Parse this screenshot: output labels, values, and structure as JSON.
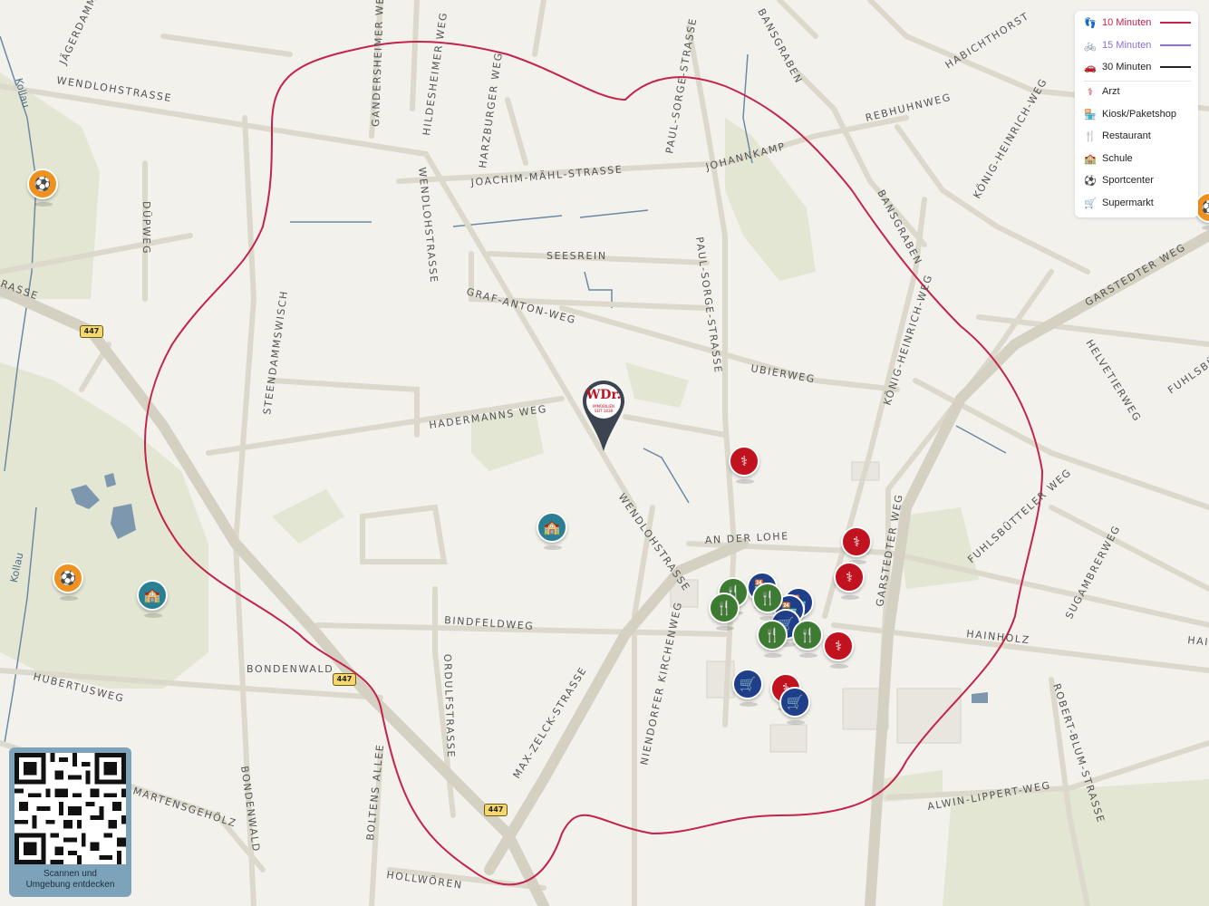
{
  "legend": {
    "travel": [
      {
        "label": "10 Minuten",
        "icon": "walk-icon",
        "color": "#c4234b"
      },
      {
        "label": "15 Minuten",
        "icon": "bike-icon",
        "color": "#8c6ee3"
      },
      {
        "label": "30 Minuten",
        "icon": "car-icon",
        "color": "#222222"
      }
    ],
    "categories": [
      {
        "label": "Arzt",
        "icon": "stethoscope-icon",
        "color": "#c1121f"
      },
      {
        "label": "Kiosk/Paketshop",
        "icon": "shop-icon",
        "color": "#1f3f8a"
      },
      {
        "label": "Restaurant",
        "icon": "cutlery-icon",
        "color": "#3e7b32"
      },
      {
        "label": "Schule",
        "icon": "school-icon",
        "color": "#2b7f94"
      },
      {
        "label": "Sportcenter",
        "icon": "stadium-icon",
        "color": "#f0901e"
      },
      {
        "label": "Supermarkt",
        "icon": "cart-icon",
        "color": "#1f3f8a"
      }
    ]
  },
  "streets": [
    "JÄGERDAMM",
    "WENDLOHSTRASSE",
    "GANDERSHEIMER WEG",
    "HILDESHEIMER WEG",
    "HARZBURGER WEG",
    "PAUL-SORGE-STRASSE",
    "BANSGRABEN",
    "HABICHTHORST",
    "REBHUHNWEG",
    "KÖNIG-HEINRICH-WEG",
    "JOACHIM-MÄHL-STRASSE",
    "JOHANNKAMP",
    "DÜPWEG",
    "WENDLOHSTRASSE",
    "SEESREIN",
    "BANSGRABEN",
    "GARSTEDTER WEG",
    "GRAF-ANTON-WEG",
    "PAUL-SORGE-STRASSE",
    "STEENDAMMSWISCH",
    "UBIERWEG",
    "KÖNIG-HEINRICH-WEG",
    "HELVETIERWEG",
    "FUHLSBÜ",
    "HADERMANNS WEG",
    "WENDLOHSTRASSE",
    "AN DER LOHE",
    "FUHLSBÜTTELER WEG",
    "SUGAMBRERWEG",
    "GARSTEDTER WEG",
    "BINDFELDWEG",
    "HAINHOLZ",
    "HAI",
    "NIENDORFER KIRCHENWEG",
    "ORDULFSTRASSE",
    "BONDENWALD",
    "HUBERTUSWEG",
    "MAX-ZELCK-STRASSE",
    "ROBERT-BLUM-STRASSE",
    "MARTENSGEHÖLZ",
    "BONDENWALD",
    "BOLTENS ALLEE",
    "ALWIN-LIPPERT-WEG",
    "HOLLWÖREN",
    "RASSE"
  ],
  "rivers": [
    "Kollau",
    "Kollau"
  ],
  "route_badges": [
    "447",
    "447",
    "447"
  ],
  "pois": [
    {
      "category": "Sportcenter",
      "icon": "stadium-icon",
      "glyph": "⚽"
    },
    {
      "category": "Sportcenter",
      "icon": "stadium-icon",
      "glyph": "⚽"
    },
    {
      "category": "Sportcenter",
      "icon": "stadium-icon",
      "glyph": "⚽"
    },
    {
      "category": "Schule",
      "icon": "school-icon",
      "glyph": "🏫"
    },
    {
      "category": "Schule",
      "icon": "school-icon",
      "glyph": "🏫"
    },
    {
      "category": "Arzt",
      "icon": "stethoscope-icon",
      "glyph": "⚕"
    },
    {
      "category": "Arzt",
      "icon": "stethoscope-icon",
      "glyph": "⚕"
    },
    {
      "category": "Arzt",
      "icon": "stethoscope-icon",
      "glyph": "⚕"
    },
    {
      "category": "Arzt",
      "icon": "stethoscope-icon",
      "glyph": "⚕"
    },
    {
      "category": "Arzt",
      "icon": "stethoscope-icon",
      "glyph": "⚕"
    },
    {
      "category": "Restaurant",
      "icon": "cutlery-icon",
      "glyph": "🍴"
    },
    {
      "category": "Restaurant",
      "icon": "cutlery-icon",
      "glyph": "🍴"
    },
    {
      "category": "Restaurant",
      "icon": "cutlery-icon",
      "glyph": "🍴"
    },
    {
      "category": "Restaurant",
      "icon": "cutlery-icon",
      "glyph": "🍴"
    },
    {
      "category": "Restaurant",
      "icon": "cutlery-icon",
      "glyph": "🍴"
    },
    {
      "category": "Kiosk/Paketshop",
      "icon": "shop-icon",
      "glyph": "🏪"
    },
    {
      "category": "Kiosk/Paketshop",
      "icon": "shop-icon",
      "glyph": "🏪"
    },
    {
      "category": "Kiosk/Paketshop",
      "icon": "shop-icon",
      "glyph": "🏪"
    },
    {
      "category": "Supermarkt",
      "icon": "cart-icon",
      "glyph": "🛒"
    },
    {
      "category": "Supermarkt",
      "icon": "cart-icon",
      "glyph": "🛒"
    },
    {
      "category": "Supermarkt",
      "icon": "cart-icon",
      "glyph": "🛒"
    }
  ],
  "marker": {
    "logo": "WDr.",
    "sub1": "IMMOBILIEN",
    "sub2": "SEIT 1838",
    "color": "#c1121f",
    "pin_color": "#3b4450"
  },
  "qr": {
    "line1": "Scannen und",
    "line2": "Umgebung entdecken"
  },
  "colors": {
    "background": "#f2f1ec",
    "road": "#dcd9cc",
    "green": "#e3e6d3",
    "water": "#4e6e8a",
    "isochrone": "#c4234b"
  }
}
